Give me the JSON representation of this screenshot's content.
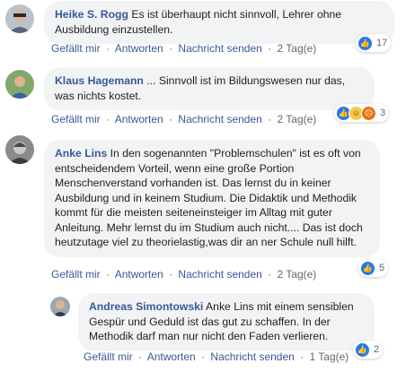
{
  "actions": {
    "like": "Gefällt mir",
    "reply": "Antworten",
    "message": "Nachricht senden",
    "separator": "·"
  },
  "comments": [
    {
      "author": "Heike S. Rogg",
      "text": "Es ist überhaupt nicht sinnvoll, Lehrer ohne Ausbildung einzustellen.",
      "time": "2 Tag(e)",
      "reaction_count": "17",
      "reactions": [
        "like-icon"
      ]
    },
    {
      "author": "Klaus Hagemann",
      "text": "... Sinnvoll ist im Bildungswesen nur das, was nichts kostet.",
      "time": "2 Tag(e)",
      "reaction_count": "3",
      "reactions": [
        "like-icon",
        "haha-icon",
        "angry-icon"
      ]
    },
    {
      "author": "Anke Lins",
      "text": "In den sogenannten \"Problemschulen\" ist es oft von entscheidendem Vorteil, wenn eine große Portion Menschenverstand vorhanden ist. Das lernst du in keiner Ausbildung und in keinem Studium. Die Didaktik und Methodik kommt für die meisten seiteneinsteiger im Alltag mit guter Anleitung. Mehr lernst du im Studium auch nicht.... Das ist doch heutzutage viel zu theorielastig,was dir an ner Schule null hilft.",
      "time": "2 Tag(e)",
      "reaction_count": "5",
      "reactions": [
        "like-icon"
      ]
    },
    {
      "author": "Andreas Simontowski",
      "mention": "Anke Lins",
      "text": "mit einem sensiblen Gespür und Geduld ist das gut zu schaffen. In der Methodik darf man nur nicht den Faden verlieren.",
      "time": "1 Tag(e)",
      "reaction_count": "2",
      "reactions": [
        "like-icon"
      ]
    }
  ]
}
